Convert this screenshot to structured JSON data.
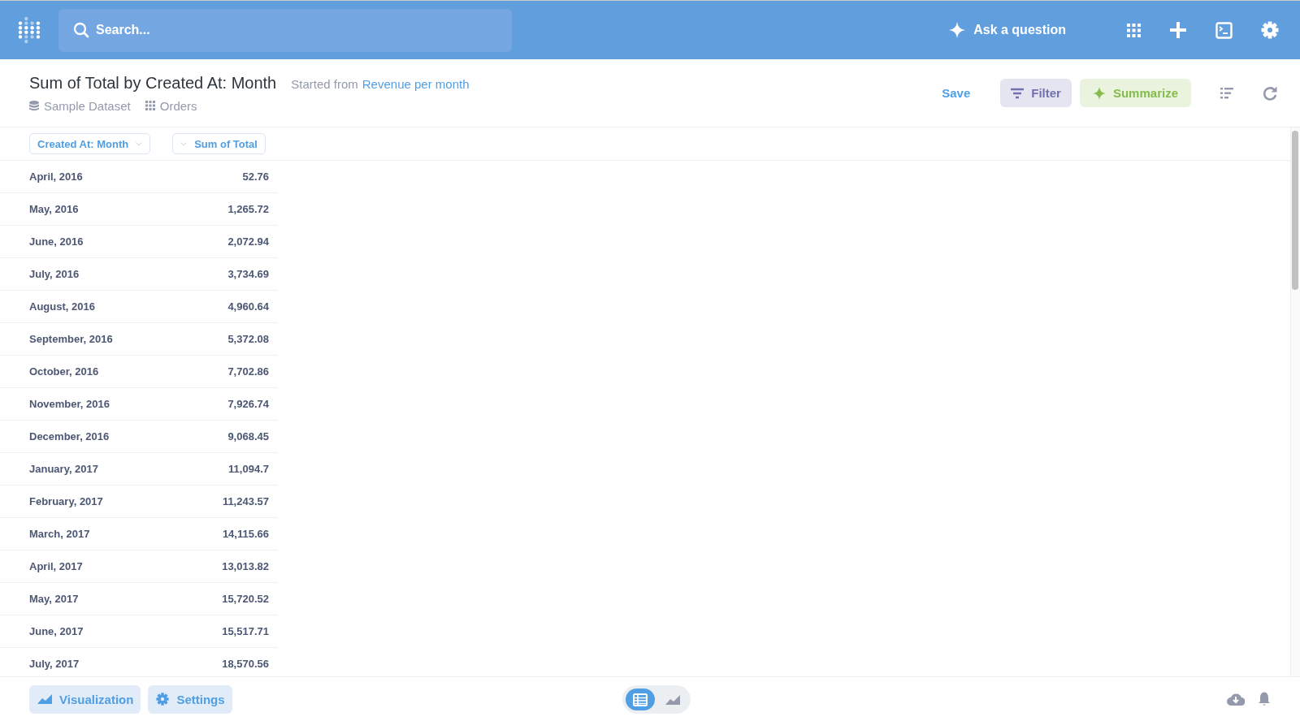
{
  "nav": {
    "search": {
      "placeholder": "Search..."
    },
    "ask_button": "Ask a question"
  },
  "question": {
    "title": "Sum of Total by Created At: Month",
    "started_from": "Started from",
    "source_link": "Revenue per month",
    "database": "Sample Dataset",
    "table": "Orders"
  },
  "actions": {
    "save": "Save",
    "filter": "Filter",
    "summarize": "Summarize"
  },
  "table": {
    "columns": [
      "Created At: Month",
      "Sum of Total"
    ],
    "rows": [
      [
        "April, 2016",
        "52.76"
      ],
      [
        "May, 2016",
        "1,265.72"
      ],
      [
        "June, 2016",
        "2,072.94"
      ],
      [
        "July, 2016",
        "3,734.69"
      ],
      [
        "August, 2016",
        "4,960.64"
      ],
      [
        "September, 2016",
        "5,372.08"
      ],
      [
        "October, 2016",
        "7,702.86"
      ],
      [
        "November, 2016",
        "7,926.74"
      ],
      [
        "December, 2016",
        "9,068.45"
      ],
      [
        "January, 2017",
        "11,094.7"
      ],
      [
        "February, 2017",
        "11,243.57"
      ],
      [
        "March, 2017",
        "14,115.66"
      ],
      [
        "April, 2017",
        "13,013.82"
      ],
      [
        "May, 2017",
        "15,720.52"
      ],
      [
        "June, 2017",
        "15,517.71"
      ],
      [
        "July, 2017",
        "18,570.56"
      ]
    ]
  },
  "footer": {
    "visualization": "Visualization",
    "settings": "Settings",
    "views": [
      {
        "kind": "table",
        "selected": true
      },
      {
        "kind": "chart",
        "selected": false
      }
    ]
  }
}
